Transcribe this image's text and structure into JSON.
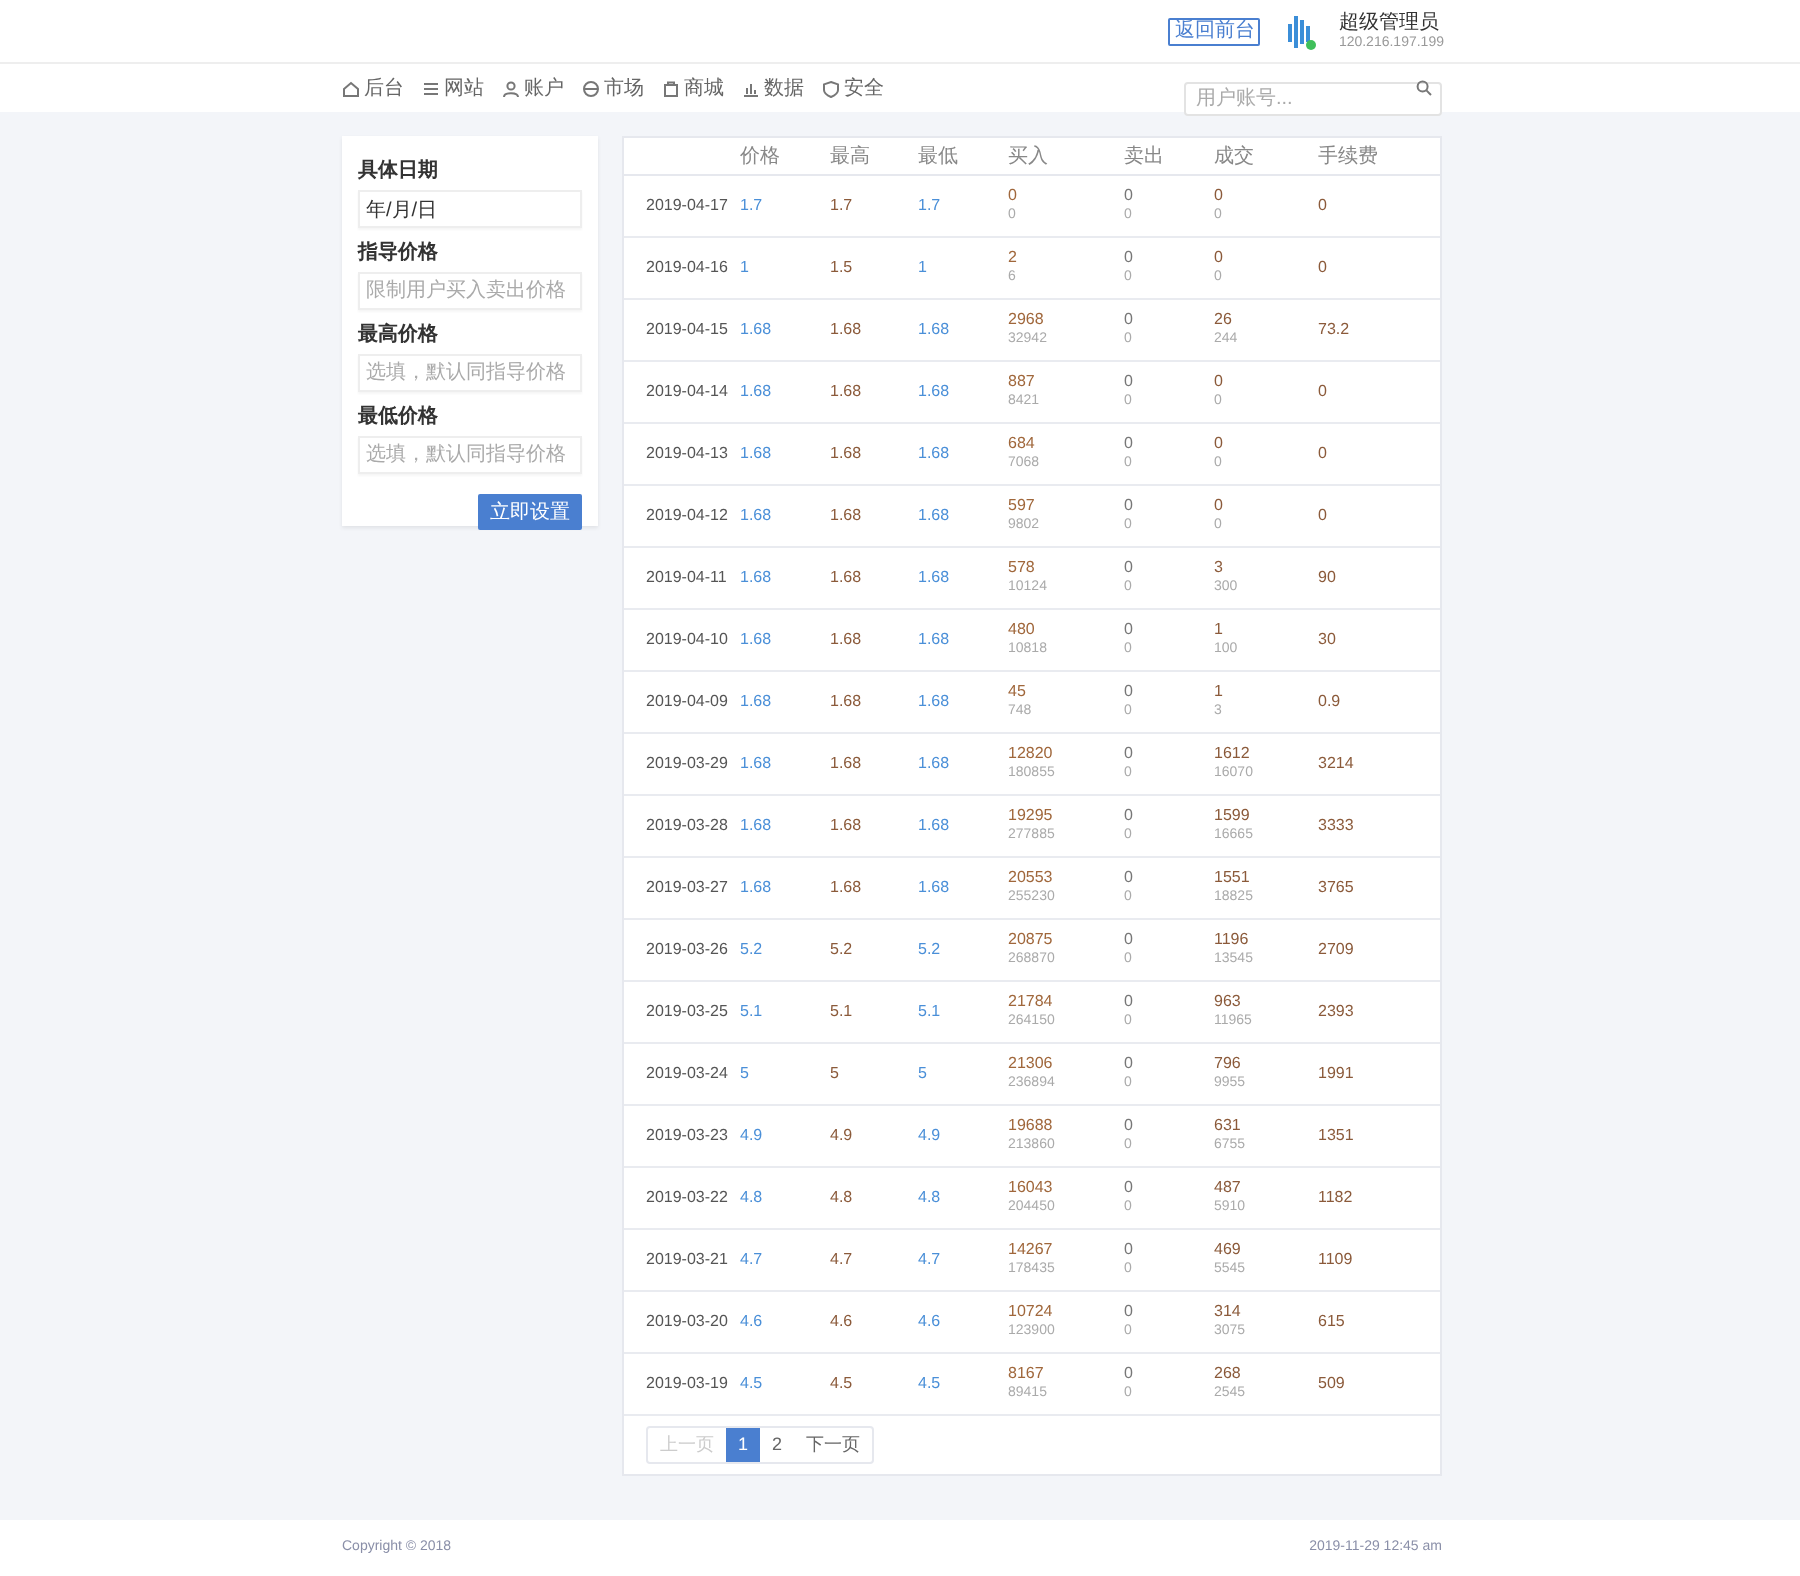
{
  "header": {
    "back_button": "返回前台",
    "user": {
      "name": "超级管理员",
      "ip": "120.216.197.199",
      "online": true
    }
  },
  "nav": [
    {
      "label": "后台"
    },
    {
      "label": "网站"
    },
    {
      "label": "账户"
    },
    {
      "label": "市场"
    },
    {
      "label": "商城"
    },
    {
      "label": "数据"
    },
    {
      "label": "安全"
    }
  ],
  "search": {
    "placeholder": "用户账号..."
  },
  "form": {
    "fields": [
      {
        "label": "具体日期",
        "value": "年/月/日"
      },
      {
        "label": "指导价格",
        "placeholder": "限制用户买入卖出价格"
      },
      {
        "label": "最高价格",
        "placeholder": "选填，默认同指导价格"
      },
      {
        "label": "最低价格",
        "placeholder": "选填，默认同指导价格"
      }
    ],
    "submit": "立即设置"
  },
  "table": {
    "columns": [
      "价格",
      "最高",
      "最低",
      "买入",
      "卖出",
      "成交",
      "手续费"
    ],
    "rows": [
      {
        "date": "2019-04-17",
        "price": "1.7",
        "high": "1.7",
        "low": "1.7",
        "buy": [
          "0",
          "0"
        ],
        "sell": [
          "0",
          "0"
        ],
        "deal": [
          "0",
          "0"
        ],
        "fee": "0"
      },
      {
        "date": "2019-04-16",
        "price": "1",
        "high": "1.5",
        "low": "1",
        "buy": [
          "2",
          "6"
        ],
        "sell": [
          "0",
          "0"
        ],
        "deal": [
          "0",
          "0"
        ],
        "fee": "0"
      },
      {
        "date": "2019-04-15",
        "price": "1.68",
        "high": "1.68",
        "low": "1.68",
        "buy": [
          "2968",
          "32942"
        ],
        "sell": [
          "0",
          "0"
        ],
        "deal": [
          "26",
          "244"
        ],
        "fee": "73.2"
      },
      {
        "date": "2019-04-14",
        "price": "1.68",
        "high": "1.68",
        "low": "1.68",
        "buy": [
          "887",
          "8421"
        ],
        "sell": [
          "0",
          "0"
        ],
        "deal": [
          "0",
          "0"
        ],
        "fee": "0"
      },
      {
        "date": "2019-04-13",
        "price": "1.68",
        "high": "1.68",
        "low": "1.68",
        "buy": [
          "684",
          "7068"
        ],
        "sell": [
          "0",
          "0"
        ],
        "deal": [
          "0",
          "0"
        ],
        "fee": "0"
      },
      {
        "date": "2019-04-12",
        "price": "1.68",
        "high": "1.68",
        "low": "1.68",
        "buy": [
          "597",
          "9802"
        ],
        "sell": [
          "0",
          "0"
        ],
        "deal": [
          "0",
          "0"
        ],
        "fee": "0"
      },
      {
        "date": "2019-04-11",
        "price": "1.68",
        "high": "1.68",
        "low": "1.68",
        "buy": [
          "578",
          "10124"
        ],
        "sell": [
          "0",
          "0"
        ],
        "deal": [
          "3",
          "300"
        ],
        "fee": "90"
      },
      {
        "date": "2019-04-10",
        "price": "1.68",
        "high": "1.68",
        "low": "1.68",
        "buy": [
          "480",
          "10818"
        ],
        "sell": [
          "0",
          "0"
        ],
        "deal": [
          "1",
          "100"
        ],
        "fee": "30"
      },
      {
        "date": "2019-04-09",
        "price": "1.68",
        "high": "1.68",
        "low": "1.68",
        "buy": [
          "45",
          "748"
        ],
        "sell": [
          "0",
          "0"
        ],
        "deal": [
          "1",
          "3"
        ],
        "fee": "0.9"
      },
      {
        "date": "2019-03-29",
        "price": "1.68",
        "high": "1.68",
        "low": "1.68",
        "buy": [
          "12820",
          "180855"
        ],
        "sell": [
          "0",
          "0"
        ],
        "deal": [
          "1612",
          "16070"
        ],
        "fee": "3214"
      },
      {
        "date": "2019-03-28",
        "price": "1.68",
        "high": "1.68",
        "low": "1.68",
        "buy": [
          "19295",
          "277885"
        ],
        "sell": [
          "0",
          "0"
        ],
        "deal": [
          "1599",
          "16665"
        ],
        "fee": "3333"
      },
      {
        "date": "2019-03-27",
        "price": "1.68",
        "high": "1.68",
        "low": "1.68",
        "buy": [
          "20553",
          "255230"
        ],
        "sell": [
          "0",
          "0"
        ],
        "deal": [
          "1551",
          "18825"
        ],
        "fee": "3765"
      },
      {
        "date": "2019-03-26",
        "price": "5.2",
        "high": "5.2",
        "low": "5.2",
        "buy": [
          "20875",
          "268870"
        ],
        "sell": [
          "0",
          "0"
        ],
        "deal": [
          "1196",
          "13545"
        ],
        "fee": "2709"
      },
      {
        "date": "2019-03-25",
        "price": "5.1",
        "high": "5.1",
        "low": "5.1",
        "buy": [
          "21784",
          "264150"
        ],
        "sell": [
          "0",
          "0"
        ],
        "deal": [
          "963",
          "11965"
        ],
        "fee": "2393"
      },
      {
        "date": "2019-03-24",
        "price": "5",
        "high": "5",
        "low": "5",
        "buy": [
          "21306",
          "236894"
        ],
        "sell": [
          "0",
          "0"
        ],
        "deal": [
          "796",
          "9955"
        ],
        "fee": "1991"
      },
      {
        "date": "2019-03-23",
        "price": "4.9",
        "high": "4.9",
        "low": "4.9",
        "buy": [
          "19688",
          "213860"
        ],
        "sell": [
          "0",
          "0"
        ],
        "deal": [
          "631",
          "6755"
        ],
        "fee": "1351"
      },
      {
        "date": "2019-03-22",
        "price": "4.8",
        "high": "4.8",
        "low": "4.8",
        "buy": [
          "16043",
          "204450"
        ],
        "sell": [
          "0",
          "0"
        ],
        "deal": [
          "487",
          "5910"
        ],
        "fee": "1182"
      },
      {
        "date": "2019-03-21",
        "price": "4.7",
        "high": "4.7",
        "low": "4.7",
        "buy": [
          "14267",
          "178435"
        ],
        "sell": [
          "0",
          "0"
        ],
        "deal": [
          "469",
          "5545"
        ],
        "fee": "1109"
      },
      {
        "date": "2019-03-20",
        "price": "4.6",
        "high": "4.6",
        "low": "4.6",
        "buy": [
          "10724",
          "123900"
        ],
        "sell": [
          "0",
          "0"
        ],
        "deal": [
          "314",
          "3075"
        ],
        "fee": "615"
      },
      {
        "date": "2019-03-19",
        "price": "4.5",
        "high": "4.5",
        "low": "4.5",
        "buy": [
          "8167",
          "89415"
        ],
        "sell": [
          "0",
          "0"
        ],
        "deal": [
          "268",
          "2545"
        ],
        "fee": "509"
      }
    ]
  },
  "pagination": [
    {
      "label": "上一页",
      "selected": false,
      "disabled": true
    },
    {
      "label": "1",
      "selected": true,
      "disabled": false
    },
    {
      "label": "2",
      "selected": false,
      "disabled": false
    },
    {
      "label": "下一页",
      "selected": false,
      "disabled": false
    }
  ],
  "footer": {
    "copyright": "Copyright © 2018",
    "time": "2019-11-29 12:45 am"
  }
}
